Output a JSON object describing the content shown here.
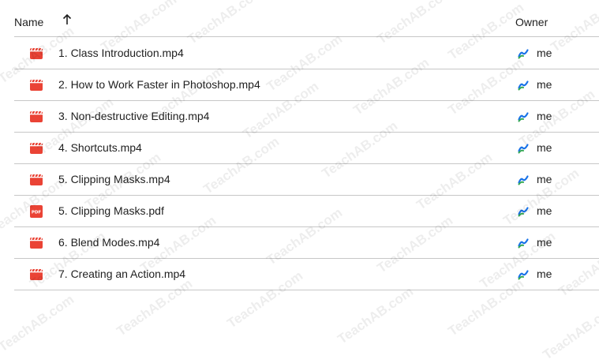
{
  "header": {
    "name_label": "Name",
    "owner_label": "Owner",
    "sort_icon": "arrow-up-icon"
  },
  "files": [
    {
      "name": "1. Class Introduction.mp4",
      "type": "video",
      "owner": "me"
    },
    {
      "name": "2. How to Work Faster in Photoshop.mp4",
      "type": "video",
      "owner": "me"
    },
    {
      "name": "3. Non-destructive Editing.mp4",
      "type": "video",
      "owner": "me"
    },
    {
      "name": "4. Shortcuts.mp4",
      "type": "video",
      "owner": "me"
    },
    {
      "name": "5. Clipping Masks.mp4",
      "type": "video",
      "owner": "me"
    },
    {
      "name": "5. Clipping Masks.pdf",
      "type": "pdf",
      "owner": "me"
    },
    {
      "name": "6. Blend Modes.mp4",
      "type": "video",
      "owner": "me"
    },
    {
      "name": "7. Creating an Action.mp4",
      "type": "video",
      "owner": "me"
    }
  ],
  "icons": {
    "video": "video-file-icon",
    "pdf": "pdf-file-icon",
    "owner": "owner-avatar-icon"
  },
  "watermark": "TeachAB.com",
  "colors": {
    "file_icon_red": "#ea4335",
    "avatar_blue": "#1a73e8",
    "avatar_green": "#34a853",
    "divider": "#c7c7c7"
  }
}
